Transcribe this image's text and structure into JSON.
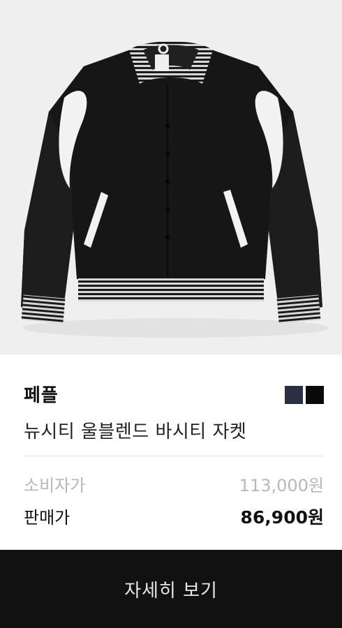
{
  "product": {
    "brand": "페플",
    "name": "뉴시티 울블렌드 바시티 자켓",
    "image_alt": "black varsity jacket",
    "color_swatches": [
      {
        "name": "navy",
        "color": "#2b3142"
      },
      {
        "name": "black",
        "color": "#0a0a0a"
      }
    ]
  },
  "pricing": {
    "retail_label": "소비자가",
    "retail_price": "113,000원",
    "sale_label": "판매가",
    "sale_price": "86,900원"
  },
  "cta": {
    "detail_label": "자세히 보기"
  }
}
